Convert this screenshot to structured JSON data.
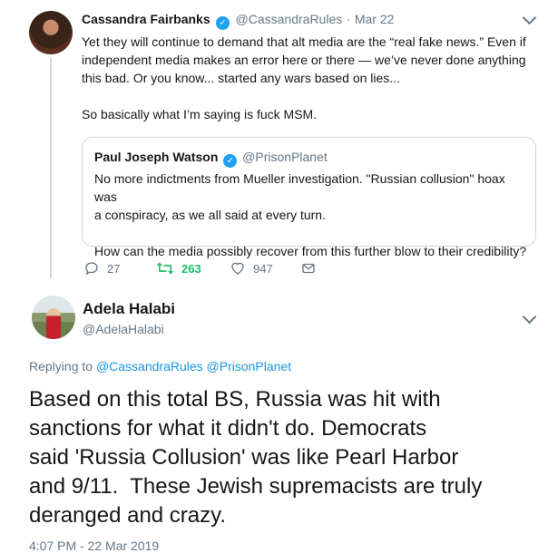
{
  "tweet1": {
    "author_name": "Cassandra Fairbanks",
    "handle": "@CassandraRules",
    "separator": "·",
    "date": "Mar 22",
    "text": "Yet they will continue to demand that alt media are the “real fake news.” Even if\nindependent media makes an error here or there — we’ve never done anything\nthis bad. Or you know... started any wars based on lies...\n\nSo basically what I’m saying is fuck MSM.",
    "quoted": {
      "author_name": "Paul Joseph Watson",
      "handle": "@PrisonPlanet",
      "text": "No more indictments from Mueller investigation. \"Russian collusion\" hoax was\na conspiracy, as we all said at every turn.\n\nHow can the media possibly recover from this further blow to their credibility?"
    },
    "actions": {
      "replies": "27",
      "retweets": "263",
      "likes": "947"
    }
  },
  "tweet2": {
    "author_name": "Adela Halabi",
    "handle": "@AdelaHalabi",
    "replying_label": "Replying to",
    "replying_handles": "@CassandraRules @PrisonPlanet",
    "text": "Based on this total BS, Russia was hit with\nsanctions for what it didn't do. Democrats\nsaid 'Russia Collusion' was like Pearl Harbor\nand 9/11.  These Jewish supremacists are truly\nderanged and crazy.",
    "timestamp": "4:07 PM - 22 Mar 2019"
  },
  "colors": {
    "accent": "#1da1f2",
    "link": "#1b95e0",
    "retweet_green": "#17bf63",
    "muted": "#657786",
    "border": "#ccd6dd"
  },
  "icons": [
    "reply-icon",
    "retweet-icon",
    "like-icon",
    "message-icon",
    "verified-badge-icon",
    "chevron-down-icon"
  ]
}
